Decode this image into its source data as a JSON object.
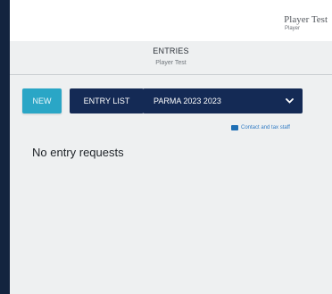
{
  "header": {
    "user_name": "Player Test",
    "user_role": "Player"
  },
  "page": {
    "title": "ENTRIES",
    "subtitle": "Player Test"
  },
  "toolbar": {
    "new_label": "NEW",
    "entry_list_label": "ENTRY LIST",
    "tournament_select": {
      "value": "PARMA 2023 2023",
      "icon": "chevron-down-icon"
    },
    "contact_link": {
      "label": "Contact and tax staff",
      "icon": "mail-icon"
    }
  },
  "content": {
    "empty_message": "No entry requests"
  },
  "colors": {
    "new_button": "#2aa6c6",
    "dark_button": "#142a55",
    "link": "#2f7ac4",
    "sidebar": "#13243f"
  }
}
